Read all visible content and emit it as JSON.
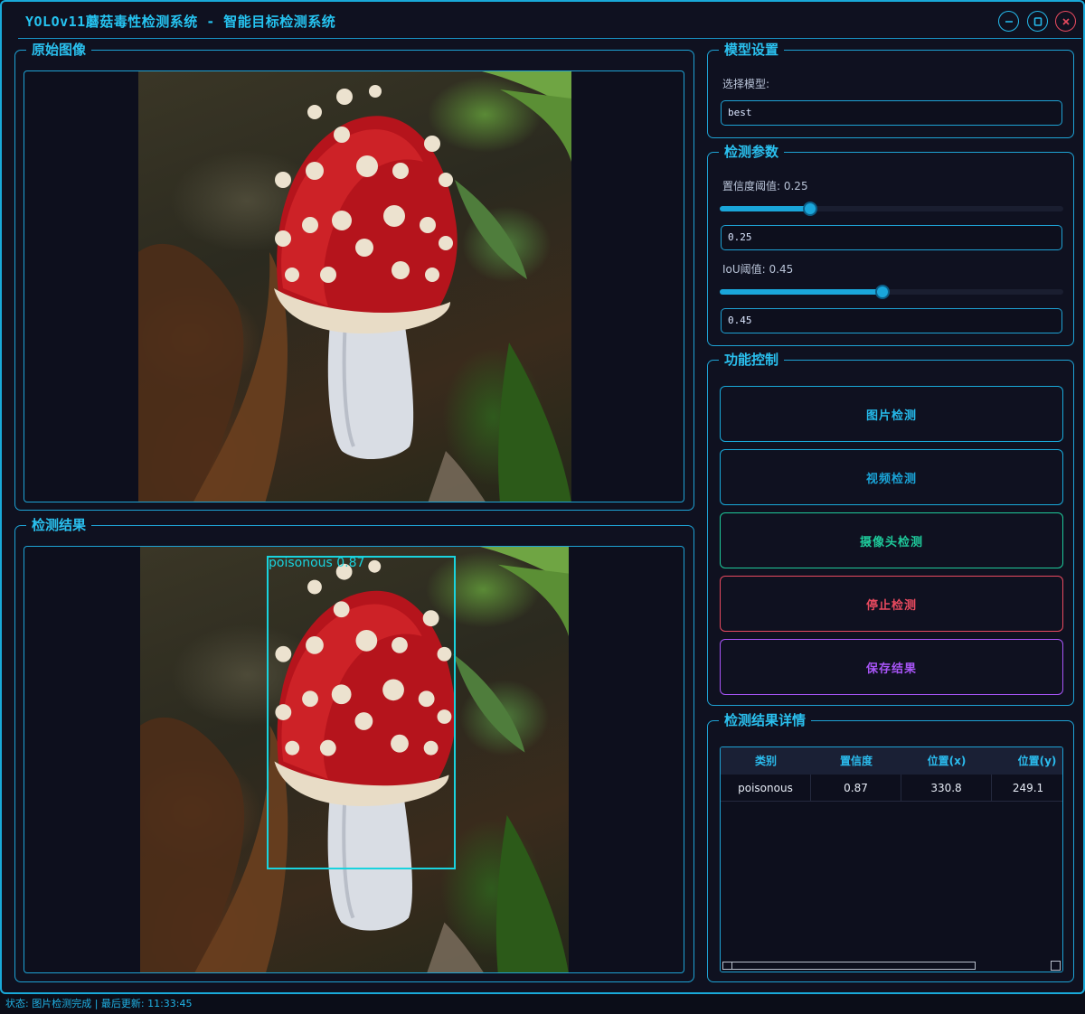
{
  "window": {
    "title": "YOLOv11蘑菇毒性检测系统 - 智能目标检测系统"
  },
  "panels": {
    "original": {
      "title": "原始图像"
    },
    "result": {
      "title": "检测结果"
    },
    "model": {
      "title": "模型设置",
      "select_label": "选择模型:",
      "selected_model": "best"
    },
    "params": {
      "title": "检测参数",
      "conf_label": "置信度阈值: 0.25",
      "conf_value": "0.25",
      "conf_level": 0.25,
      "iou_label": "IoU阈值: 0.45",
      "iou_value": "0.45",
      "iou_level": 0.45
    },
    "controls": {
      "title": "功能控制",
      "image_detect": "图片检测",
      "video_detect": "视频检测",
      "camera_detect": "摄像头检测",
      "stop_detect": "停止检测",
      "save_result": "保存结果"
    },
    "details": {
      "title": "检测结果详情",
      "columns": [
        "类别",
        "置信度",
        "位置(x)",
        "位置(y)"
      ],
      "rows": [
        [
          "poisonous",
          "0.87",
          "330.8",
          "249.1"
        ]
      ]
    }
  },
  "detection": {
    "label": "poisonous 0.87"
  },
  "status": {
    "text": "状态: 图片检测完成 | 最后更新: 11:33:45"
  },
  "colors": {
    "accent": "#19b6ea",
    "close": "#e84a5f",
    "video": "#19a9d9",
    "camera": "#1ec99a",
    "stop": "#e84a5f",
    "save": "#a855f7",
    "box": "#19d3de"
  }
}
